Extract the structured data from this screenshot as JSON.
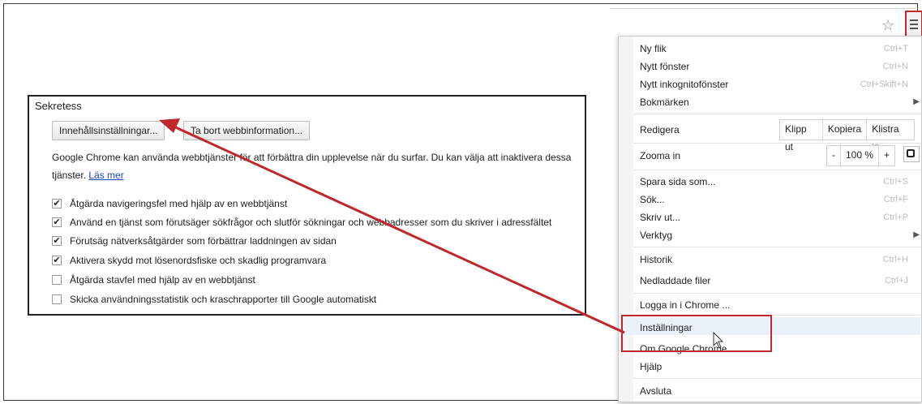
{
  "toolbar": {
    "star_icon": "star-icon",
    "menu_icon": "hamburger-menu-icon"
  },
  "menu": {
    "items": [
      {
        "label": "Ny flik",
        "shortcut": "Ctrl+T"
      },
      {
        "label": "Nytt fönster",
        "shortcut": "Ctrl+N"
      },
      {
        "label": "Nytt inkognitofönster",
        "shortcut": "Ctrl+Skift+N"
      },
      {
        "label": "Bokmärken",
        "shortcut": ""
      },
      {
        "label": "Redigera",
        "shortcut": ""
      },
      {
        "label": "Zooma in",
        "shortcut": ""
      },
      {
        "label": "Spara sida som...",
        "shortcut": "Ctrl+S"
      },
      {
        "label": "Sök...",
        "shortcut": "Ctrl+F"
      },
      {
        "label": "Skriv ut...",
        "shortcut": "Ctrl+P"
      },
      {
        "label": "Verktyg",
        "shortcut": ""
      },
      {
        "label": "Historik",
        "shortcut": "Ctrl+H"
      },
      {
        "label": "Nedladdade filer",
        "shortcut": "Ctrl+J"
      },
      {
        "label": "Logga in i Chrome ...",
        "shortcut": ""
      },
      {
        "label": "Inställningar",
        "shortcut": ""
      },
      {
        "label": "Om Google Chrome",
        "shortcut": ""
      },
      {
        "label": "Hjälp",
        "shortcut": ""
      },
      {
        "label": "Avsluta",
        "shortcut": ""
      }
    ],
    "edit": {
      "cut": "Klipp ut",
      "copy": "Kopiera",
      "paste": "Klistra in"
    },
    "zoom": {
      "minus": "-",
      "value": "100 %",
      "plus": "+"
    }
  },
  "privacy": {
    "heading": "Sekretess",
    "content_settings_button": "Innehållsinställningar...",
    "clear_data_button": "Ta bort webbinformation...",
    "description": "Google Chrome kan använda webbtjänster för att förbättra din upplevelse när du surfar. Du kan välja att inaktivera dessa tjänster.",
    "learn_more": "Läs mer",
    "options": [
      {
        "label": "Åtgärda navigeringsfel med hjälp av en webbtjänst",
        "checked": true
      },
      {
        "label": "Använd en tjänst som förutsäger sökfrågor och slutför sökningar och webbadresser som du skriver i adressfältet",
        "checked": true
      },
      {
        "label": "Förutsäg nätverksåtgärder som förbättrar laddningen av sidan",
        "checked": true
      },
      {
        "label": "Aktivera skydd mot lösenordsfiske och skadlig programvara",
        "checked": true
      },
      {
        "label": "Åtgärda stavfel med hjälp av en webbtjänst",
        "checked": false
      },
      {
        "label": "Skicka användningsstatistik och kraschrapporter till Google automatiskt",
        "checked": false
      }
    ]
  },
  "colors": {
    "annotation_red": "#c0282a",
    "link": "#1a44b8"
  }
}
